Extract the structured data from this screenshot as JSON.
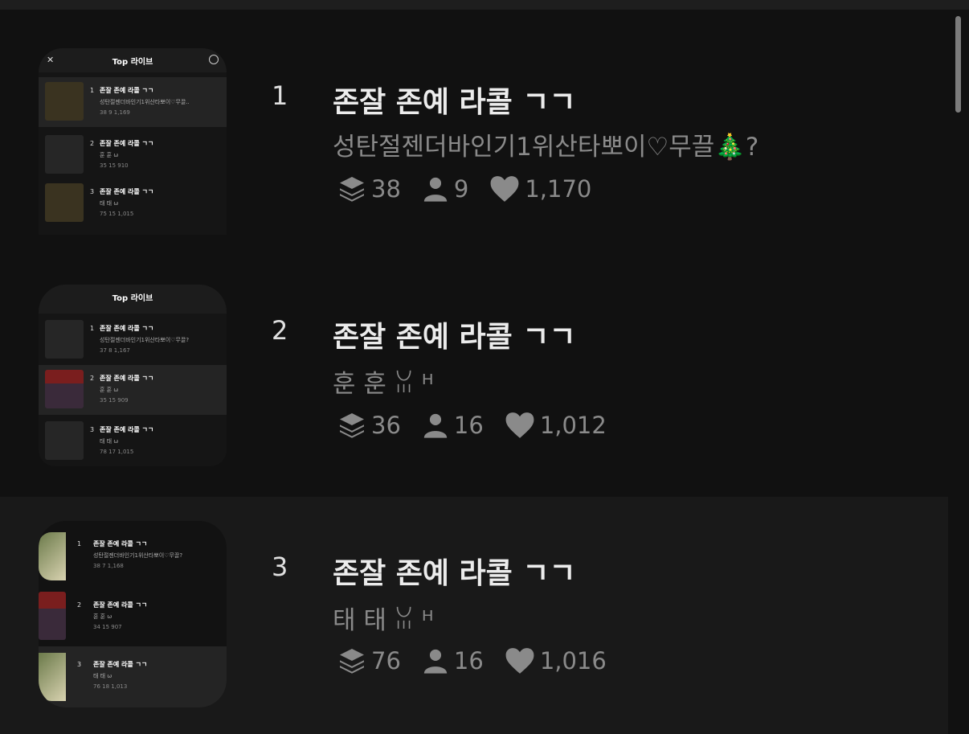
{
  "rows": [
    {
      "rank": "1",
      "title": "존잘 존예 라콜 ㄱㄱ",
      "subtitle": "성탄절젠더바인기1위산타뽀이♡무끌🎄?",
      "stats": {
        "layers": "38",
        "users": "9",
        "likes": "1,170"
      },
      "thumb": {
        "header_title": "Top 라이브",
        "items": [
          {
            "num": "1",
            "name": "존잘 존예 라콜 ㄱㄱ",
            "sub": "성탄절젠더바인기1위산타뽀이♡무끌..",
            "stats": "38   9   1,169"
          },
          {
            "num": "2",
            "name": "존잘 존예 라콜 ㄱㄱ",
            "sub": "훈 훈 ω",
            "stats": "35   15   910"
          },
          {
            "num": "3",
            "name": "존잘 존예 라콜 ㄱㄱ",
            "sub": "태 태 ω",
            "stats": "75   15   1,015"
          }
        ]
      }
    },
    {
      "rank": "2",
      "title": "존잘 존예 라콜 ㄱㄱ",
      "subtitle": "훈 훈 ꈍ ᴴ",
      "stats": {
        "layers": "36",
        "users": "16",
        "likes": "1,012"
      },
      "thumb": {
        "header_title": "Top 라이브",
        "items": [
          {
            "num": "1",
            "name": "존잘 존예 라콜 ㄱㄱ",
            "sub": "성탄절젠더바인기1위산타뽀이♡무끌?",
            "stats": "37   8   1,167"
          },
          {
            "num": "2",
            "name": "존잘 존예 라콜 ㄱㄱ",
            "sub": "훈 훈 ω",
            "stats": "35   15   909"
          },
          {
            "num": "3",
            "name": "존잘 존예 라콜 ㄱㄱ",
            "sub": "태 태 ω",
            "stats": "78   17   1,015"
          }
        ]
      }
    },
    {
      "rank": "3",
      "title": "존잘 존예 라콜 ㄱㄱ",
      "subtitle": "태 태 ꈍ ᴴ",
      "stats": {
        "layers": "76",
        "users": "16",
        "likes": "1,016"
      },
      "thumb": {
        "header_title": "",
        "items": [
          {
            "num": "1",
            "name": "존잘 존예 라콜 ㄱㄱ",
            "sub": "성탄절젠더바인기1위산타뽀이♡무끌?",
            "stats": "38   7   1,168"
          },
          {
            "num": "2",
            "name": "존잘 존예 라콜 ㄱㄱ",
            "sub": "훈 훈 ω",
            "stats": "34   15   907"
          },
          {
            "num": "3",
            "name": "존잘 존예 라콜 ㄱㄱ",
            "sub": "태 태 ω",
            "stats": "76   18   1,013"
          }
        ]
      }
    }
  ],
  "icons": {
    "layers": "layers-icon",
    "users": "user-icon",
    "likes": "heart-icon"
  },
  "colors": {
    "background": "#111111",
    "row_highlight": "#191919",
    "muted_text": "#8a8a8a",
    "scrollbar": "#7c7c7c"
  }
}
